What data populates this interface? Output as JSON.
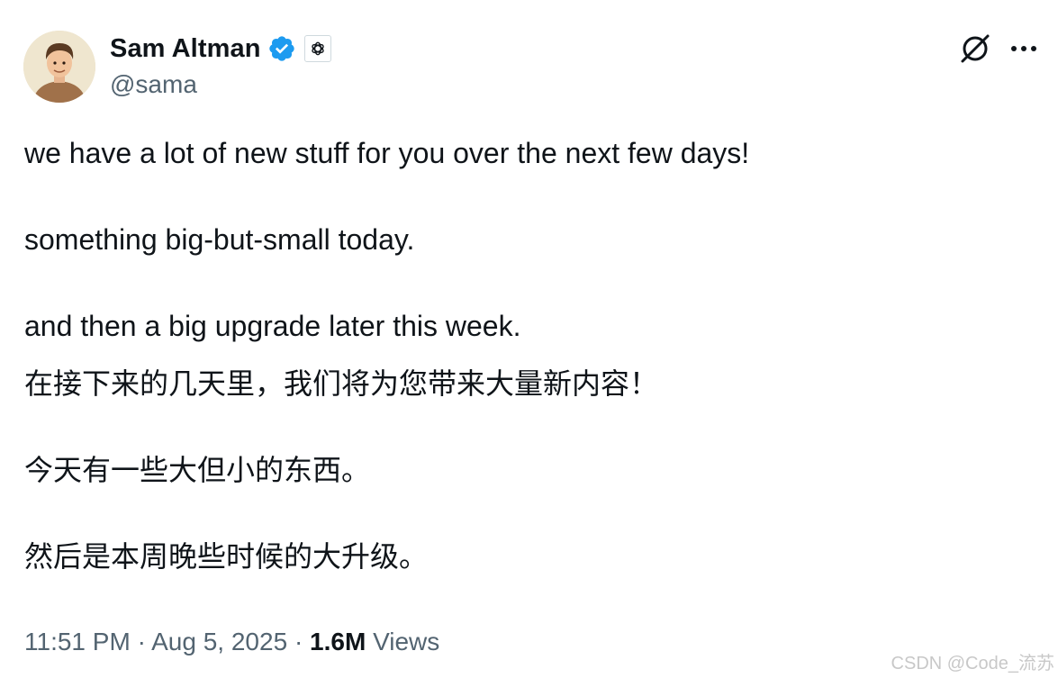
{
  "author": {
    "display_name": "Sam Altman",
    "handle": "@sama",
    "verified_icon": "verified-badge-icon",
    "affiliate_icon": "openai-logo-icon",
    "verified_color": "#1d9bf0"
  },
  "header_actions": {
    "grok_icon": "grok-icon",
    "more_icon": "more-horizontal-icon"
  },
  "tweet": {
    "lines_en": [
      "we have a lot of new stuff for you over the next few days!",
      "something big-but-small today.",
      "and then a big upgrade later this week."
    ],
    "lines_zh": [
      "在接下来的几天里，我们将为您带来大量新内容！",
      "今天有一些大但小的东西。",
      "然后是本周晚些时候的大升级。"
    ]
  },
  "meta": {
    "time": "11:51 PM",
    "separator": "·",
    "date": "Aug 5, 2025",
    "views_count": "1.6M",
    "views_label": "Views"
  },
  "watermark": "CSDN @Code_流苏",
  "colors": {
    "text_primary": "#0f1419",
    "text_secondary": "#536471",
    "accent": "#1d9bf0"
  }
}
